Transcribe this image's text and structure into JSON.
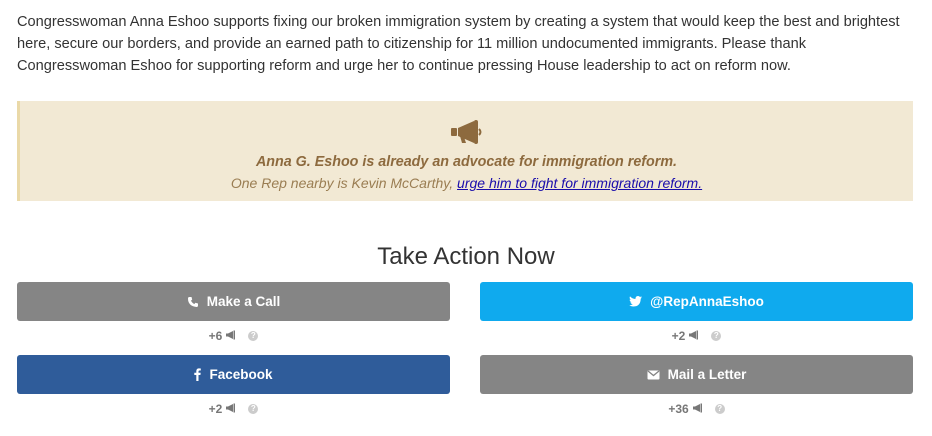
{
  "intro": {
    "text": "Congresswoman Anna Eshoo supports fixing our broken immigration system by creating a system that would keep the best and brightest here, secure our borders, and provide an earned path to citizenship for 11 million undocumented immigrants. Please thank Congresswoman Eshoo for supporting reform and urge her to continue pressing House leadership to act on reform now."
  },
  "notice": {
    "icon": "megaphone-icon",
    "headline": "Anna G. Eshoo is already an advocate for immigration reform.",
    "nearby_text": "One Rep nearby is Kevin McCarthy,",
    "link_text": "urge him to fight for immigration reform."
  },
  "take_action": {
    "title": "Take Action Now",
    "buttons": [
      {
        "label": "Make a Call",
        "icon": "phone-icon",
        "count": "+6",
        "color": "#858585"
      },
      {
        "label": "@RepAnnaEshoo",
        "icon": "twitter-icon",
        "count": "+2",
        "color": "#0faaee"
      },
      {
        "label": "Facebook",
        "icon": "facebook-icon",
        "count": "+2",
        "color": "#2f5c9a"
      },
      {
        "label": "Mail a Letter",
        "icon": "envelope-icon",
        "count": "+36",
        "color": "#858585"
      }
    ],
    "help_glyph": "?"
  }
}
